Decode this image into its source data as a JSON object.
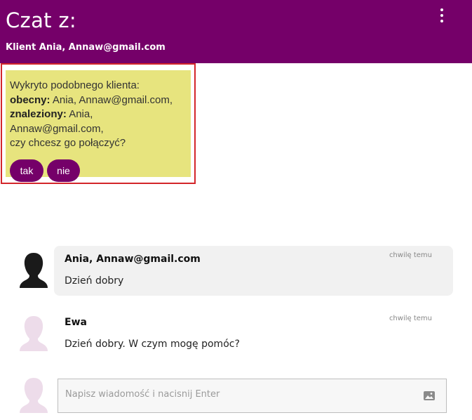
{
  "header": {
    "title": "Czat z:",
    "subtitle": "Klient Ania, Annaw@gmail.com",
    "menu_icon": "more-vert-icon"
  },
  "merge_prompt": {
    "intro": "Wykryto podobnego klienta:",
    "current_label": "obecny:",
    "current_value": " Ania, Annaw@gmail.com,",
    "found_label": "znaleziony:",
    "found_value": " Ania, Annaw@gmail.com,",
    "question": "czy chcesz go połączyć?",
    "yes_label": "tak",
    "no_label": "nie",
    "highlight_color": "#d3262a",
    "box_color": "#e7e47e"
  },
  "messages": [
    {
      "author": "Ania, Annaw@gmail.com",
      "time": "chwilę temu",
      "text": "Dzień dobry",
      "avatar_icon": "user-silhouette-icon"
    },
    {
      "author": "Ewa",
      "time": "chwilę temu",
      "text": "Dzień dobry. W czym mogę pomóc?",
      "avatar_icon": "user-silhouette-icon"
    }
  ],
  "composer": {
    "placeholder": "Napisz wiadomość i nacisnij Enter",
    "attach_icon": "image-icon"
  },
  "colors": {
    "brand": "#750069",
    "customer_avatar": "#1a1a1a",
    "agent_avatar": "#eddcea"
  }
}
